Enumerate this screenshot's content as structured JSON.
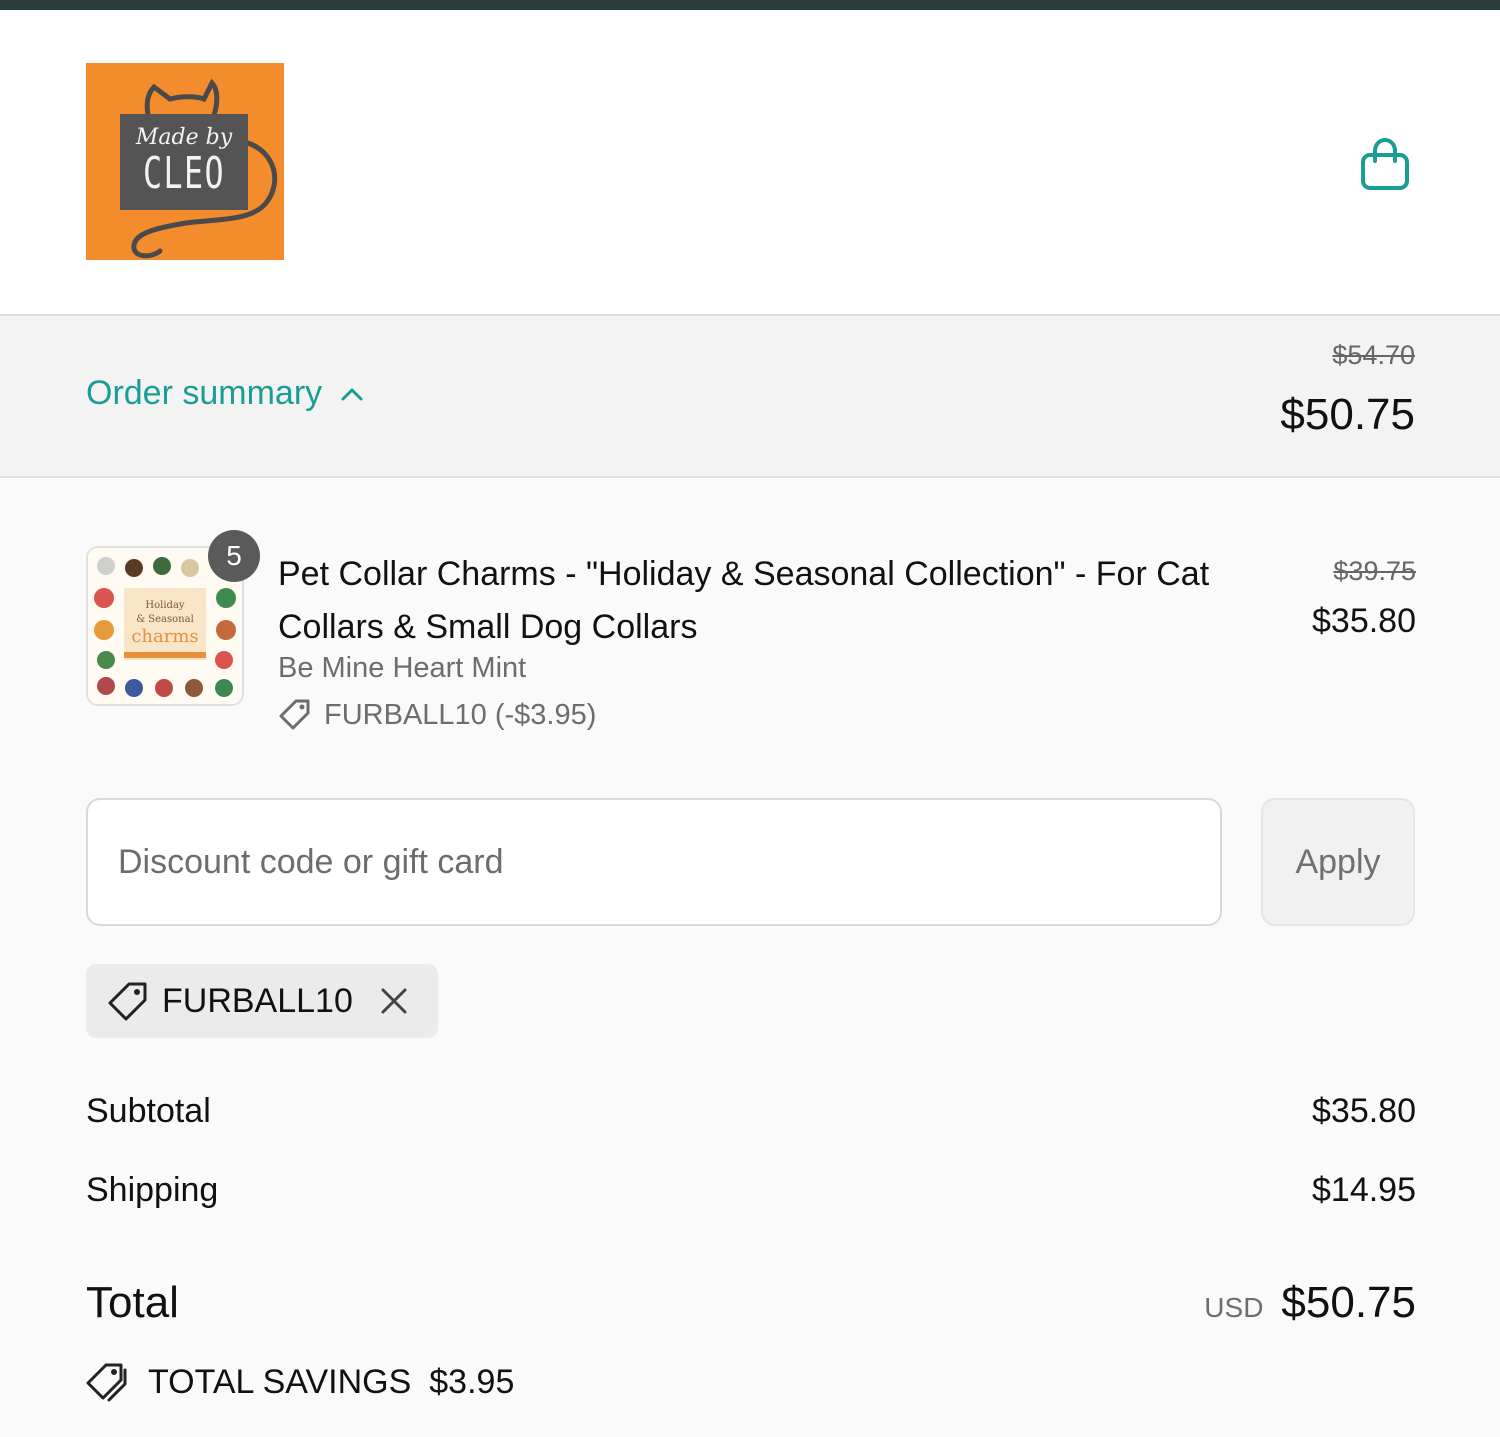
{
  "header": {
    "logo_text_top": "Made by",
    "logo_text_name": "CLEO",
    "cart_icon": "shopping-bag-icon",
    "accent_color": "#1a9e93",
    "logo_color": "#f28c2c"
  },
  "summary": {
    "toggle_label": "Order summary",
    "toggle_icon": "chevron-up-icon",
    "original_total": "$54.70",
    "total": "$50.75"
  },
  "line_item": {
    "quantity": "5",
    "title": "Pet Collar Charms - \"Holiday & Seasonal Collection\" - For Cat Collars & Small Dog Collars",
    "variant": "Be Mine Heart Mint",
    "discount": "FURBALL10 (-$3.95)",
    "original_price": "$39.75",
    "price": "$35.80",
    "thumb_text_1": "Holiday",
    "thumb_text_2": "& Seasonal",
    "thumb_text_3": "charms"
  },
  "discount_field": {
    "placeholder": "Discount code or gift card",
    "apply_label": "Apply"
  },
  "applied_code": {
    "code": "FURBALL10",
    "tag_icon": "tag-icon",
    "remove_icon": "close-icon"
  },
  "totals": {
    "subtotal_label": "Subtotal",
    "subtotal_value": "$35.80",
    "shipping_label": "Shipping",
    "shipping_value": "$14.95",
    "total_label": "Total",
    "currency": "USD",
    "total_value": "$50.75",
    "savings_label": "TOTAL SAVINGS",
    "savings_value": "$3.95"
  }
}
